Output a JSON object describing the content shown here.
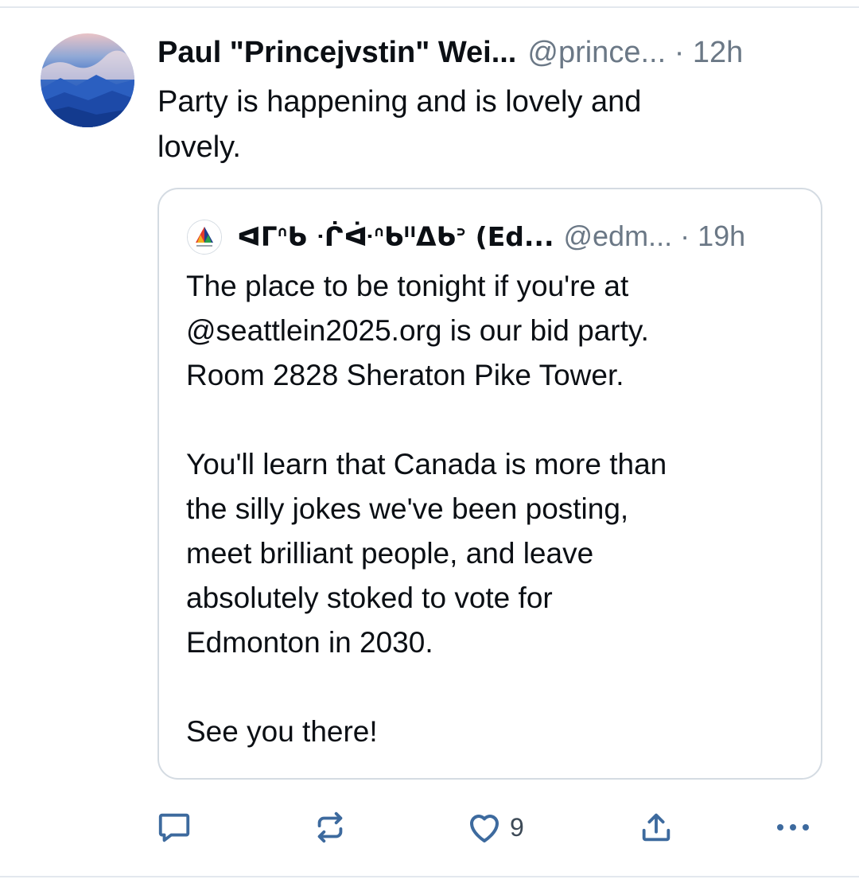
{
  "post": {
    "author_name": "Paul \"Princejvstin\" Wei...",
    "author_handle": "@prince...",
    "time": "· 12h",
    "text_line1": "Party is happening and is lovely and",
    "text_line2": "lovely."
  },
  "quote": {
    "author_name": "ᐊᒥᐢᑲ ᐧᒌᐚᐢᑲᐦᐃᑲᐣ (Ed...",
    "author_handle": "@edm...",
    "time": "· 19h",
    "paragraph1_lines": [
      "The place to be tonight if you're at",
      "@seattlein2025.org is our bid party.",
      "Room 2828 Sheraton Pike Tower."
    ],
    "paragraph2_lines": [
      "You'll learn that Canada is more than",
      "the silly jokes we've been posting,",
      "meet brilliant people, and leave",
      "absolutely stoked to vote for",
      "Edmonton in 2030."
    ],
    "paragraph3_lines": [
      "See you there!"
    ]
  },
  "actions": {
    "reply_icon": "speech-bubble-icon",
    "repost_icon": "repost-arrows-icon",
    "like_icon": "heart-icon",
    "like_count": "9",
    "share_icon": "share-upload-icon",
    "more_icon": "ellipsis-icon"
  },
  "colors": {
    "text": "#0b0f14",
    "muted": "#6b7886",
    "icon": "#3d6a9e",
    "border": "#d4dbe2"
  }
}
